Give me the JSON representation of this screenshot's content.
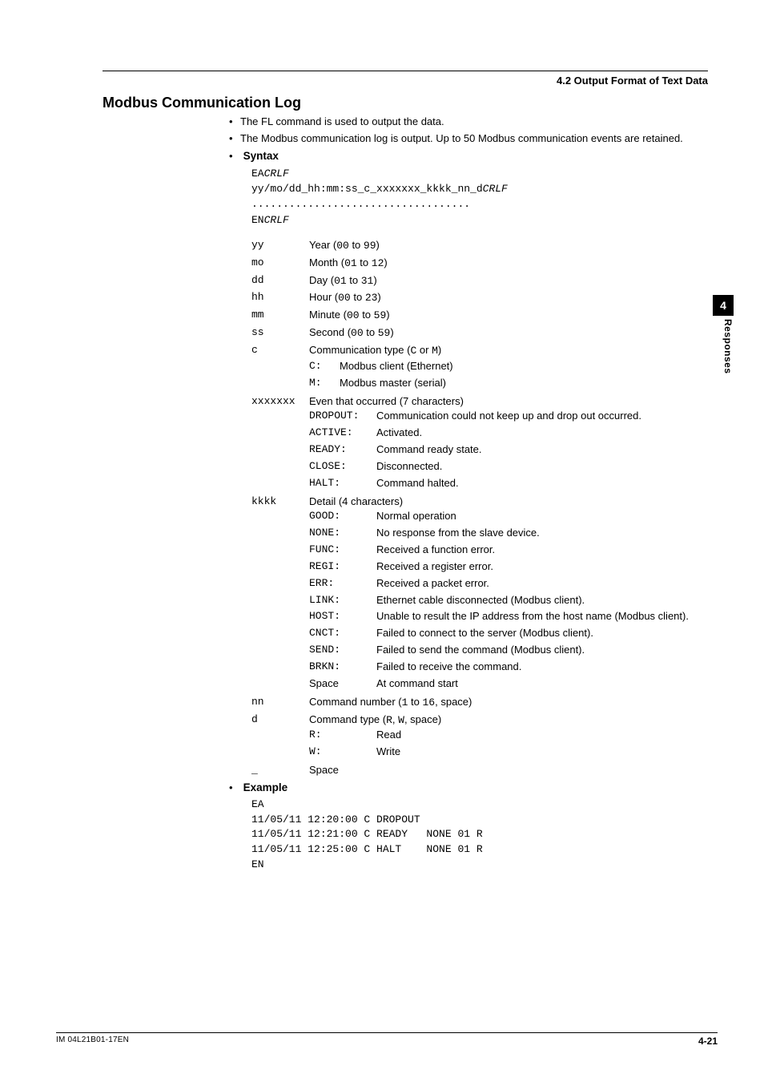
{
  "header": {
    "section": "4.2  Output Format of Text Data"
  },
  "title": "Modbus Communication Log",
  "intro": {
    "bullet1": "The FL command is used to output the data.",
    "bullet2": "The Modbus communication log is output. Up to 50 Modbus communication events are retained."
  },
  "syntax": {
    "heading": "Syntax",
    "l1a": "EA",
    "l1b": "CRLF",
    "l2a": "yy/mo/dd_hh:mm:ss_c_xxxxxxx_kkkk_nn_d",
    "l2b": "CRLF",
    "l3": "...................................",
    "l4a": "EN",
    "l4b": "CRLF"
  },
  "defs": {
    "yy": {
      "k": "yy",
      "label": "Year (",
      "r0": "00",
      "mid": " to ",
      "r1": "99",
      "close": ")"
    },
    "mo": {
      "k": "mo",
      "label": "Month (",
      "r0": "01",
      "mid": " to ",
      "r1": "12",
      "close": ")"
    },
    "dd": {
      "k": "dd",
      "label": "Day (",
      "r0": "01",
      "mid": " to ",
      "r1": "31",
      "close": ")"
    },
    "hh": {
      "k": "hh",
      "label": "Hour (",
      "r0": "00",
      "mid": " to ",
      "r1": "23",
      "close": ")"
    },
    "mm": {
      "k": "mm",
      "label": "Minute (",
      "r0": "00",
      "mid": " to ",
      "r1": "59",
      "close": ")"
    },
    "ss": {
      "k": "ss",
      "label": "Second (",
      "r0": "00",
      "mid": " to ",
      "r1": "59",
      "close": ")"
    },
    "c": {
      "k": "c",
      "label": "Communication type (",
      "o0": "C",
      "mid": " or ",
      "o1": "M",
      "close": ")",
      "sub": [
        {
          "k": "C:",
          "v": "Modbus client (Ethernet)"
        },
        {
          "k": "M:",
          "v": "Modbus master (serial)"
        }
      ]
    },
    "xx": {
      "k": "xxxxxxx",
      "label": "Even that occurred (7 characters)",
      "sub": [
        {
          "k": "DROPOUT:",
          "v": "Communication could not keep up and drop out occurred."
        },
        {
          "k": "ACTIVE:",
          "v": "Activated."
        },
        {
          "k": "READY:",
          "v": "Command ready state."
        },
        {
          "k": "CLOSE:",
          "v": "Disconnected."
        },
        {
          "k": "HALT:",
          "v": "Command halted."
        }
      ]
    },
    "kk": {
      "k": "kkkk",
      "label": "Detail (4 characters)",
      "sub": [
        {
          "k": "GOOD:",
          "v": "Normal operation"
        },
        {
          "k": "NONE:",
          "v": "No response from the slave device."
        },
        {
          "k": "FUNC:",
          "v": "Received a function error."
        },
        {
          "k": "REGI:",
          "v": "Received a register error."
        },
        {
          "k": "ERR:",
          "v": "Received a packet error."
        },
        {
          "k": "LINK:",
          "v": "Ethernet cable disconnected (Modbus client)."
        },
        {
          "k": "HOST:",
          "v": "Unable to result the IP address from the host name (Modbus client)."
        },
        {
          "k": "CNCT:",
          "v": "Failed to connect to the server (Modbus client)."
        },
        {
          "k": "SEND:",
          "v": "Failed to send the command (Modbus client)."
        },
        {
          "k": "BRKN:",
          "v": "Failed to receive the command."
        },
        {
          "k": "Space",
          "km": false,
          "v": "At command start"
        }
      ]
    },
    "nn": {
      "k": "nn",
      "label": "Command number (",
      "r0": "1",
      "mid": " to ",
      "r1": "16",
      "close": ", space)"
    },
    "d": {
      "k": "d",
      "label": "Command type (",
      "o0": "R",
      "mid": ", ",
      "o1": "W",
      "close": ", space)",
      "sub": [
        {
          "k": "R:",
          "v": "Read"
        },
        {
          "k": "W:",
          "v": "Write"
        }
      ]
    },
    "us": {
      "k": "_",
      "label": "Space"
    }
  },
  "example": {
    "heading": "Example",
    "lines": "EA\n11/05/11 12:20:00 C DROPOUT\n11/05/11 12:21:00 C READY   NONE 01 R\n11/05/11 12:25:00 C HALT    NONE 01 R\nEN"
  },
  "sidebar": {
    "num": "4",
    "label": "Responses"
  },
  "footer": {
    "doc": "IM 04L21B01-17EN",
    "page": "4-21"
  }
}
